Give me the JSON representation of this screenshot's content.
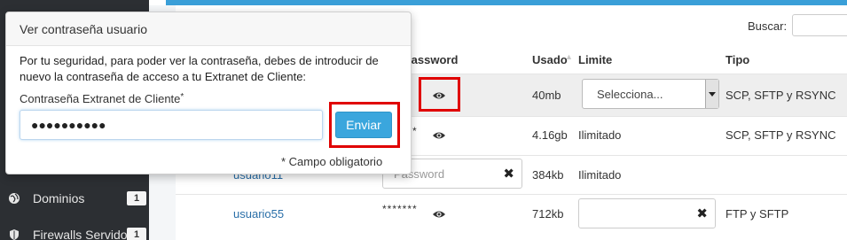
{
  "sidebar": {
    "items": [
      {
        "label": "Dominios",
        "badge": "1",
        "icon": "globe-icon"
      },
      {
        "label": "Firewalls Servidor",
        "badge": "1",
        "icon": "shield-icon"
      }
    ]
  },
  "search": {
    "label": "Buscar:"
  },
  "table": {
    "headers": {
      "password": "Password",
      "usado": "Usado",
      "limite": "Limite",
      "tipo": "Tipo"
    },
    "rows": [
      {
        "password_mask": "",
        "usado": "40mb",
        "limite_select": "Selecciona...",
        "tipo": "SCP, SFTP y RSYNC"
      },
      {
        "password_mask": "*",
        "usado": "4.16gb",
        "limite": "Ilimitado",
        "tipo": "SCP, SFTP y RSYNC"
      },
      {
        "user": "usuario11",
        "password_placeholder": "Password",
        "usado": "384kb",
        "limite": "Ilimitado",
        "tipo": ""
      },
      {
        "user": "usuario55",
        "password_mask": "*******",
        "usado": "712kb",
        "limite": "",
        "tipo": "FTP y SFTP"
      }
    ]
  },
  "popover": {
    "title": "Ver contraseña usuario",
    "body": "Por tu seguridad, para poder ver la contraseña, debes de introducir de nuevo la contraseña de acceso a tu Extranet de Cliente:",
    "field_label": "Contraseña Extranet de Cliente",
    "required_mark": "*",
    "password_value": "●●●●●●●●●●",
    "submit_label": "Enviar",
    "note": "* Campo obligatorio"
  },
  "colors": {
    "sidebar_bg": "#2c2f33",
    "accent": "#3aa6dd",
    "highlight_box": "#e00000",
    "link": "#2a6fa8"
  }
}
